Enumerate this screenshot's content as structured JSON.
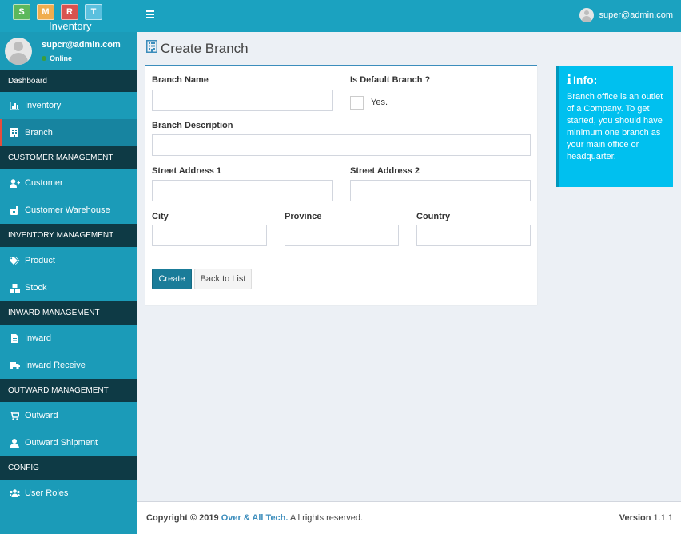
{
  "app": {
    "logo_tiles": [
      "S",
      "M",
      "R",
      "T"
    ],
    "logo_text": "Inventory"
  },
  "user": {
    "name": "supcr@admin.com",
    "status": "Online",
    "top_email": "super@admin.com"
  },
  "sidebar": {
    "dashboard": "Dashboard",
    "items_inventory": "Inventory",
    "items_branch": "Branch",
    "customer_header": "CUSTOMER MANAGEMENT",
    "customer": "Customer",
    "customer_warehouse": "Customer Warehouse",
    "inventory_header": "INVENTORY MANAGEMENT",
    "product": "Product",
    "stock": "Stock",
    "inward_header": "INWARD MANAGEMENT",
    "inward": "Inward",
    "inward_receive": "Inward Receive",
    "outward_header": "OUTWARD MANAGEMENT",
    "outward": "Outward",
    "outward_shipment": "Outward Shipment",
    "config_header": "CONFIG",
    "user_roles": "User Roles"
  },
  "page": {
    "title": "Create Branch"
  },
  "form": {
    "branch_name_label": "Branch Name",
    "branch_name_value": "",
    "is_default_label": "Is Default Branch ?",
    "is_default_checkbox_text": "Yes.",
    "branch_description_label": "Branch Description",
    "branch_description_value": "",
    "street1_label": "Street Address 1",
    "street1_value": "",
    "street2_label": "Street Address 2",
    "street2_value": "",
    "city_label": "City",
    "city_value": "",
    "province_label": "Province",
    "province_value": "",
    "country_label": "Country",
    "country_value": "",
    "create_button": "Create",
    "back_button": "Back to List"
  },
  "info": {
    "title": "Info:",
    "body": "Branch office is an outlet of a Company. To get started, you should have minimum one branch as your main office or headquarter."
  },
  "footer": {
    "copyright": "Copyright © 2019",
    "company": "Over & All Tech.",
    "rights": "All rights reserved.",
    "version_label": "Version",
    "version_value": "1.1.1"
  },
  "colors": {
    "sidebar": "#1b9bb8",
    "topbar": "#1ba2c0",
    "section_header": "#0e3a45",
    "primary_button": "#1a7c99",
    "info_box": "#00c0ef",
    "tile_s": "#5cb85c",
    "tile_m": "#f0ad4e",
    "tile_r": "#d9534f",
    "tile_t": "#5bc0de"
  }
}
